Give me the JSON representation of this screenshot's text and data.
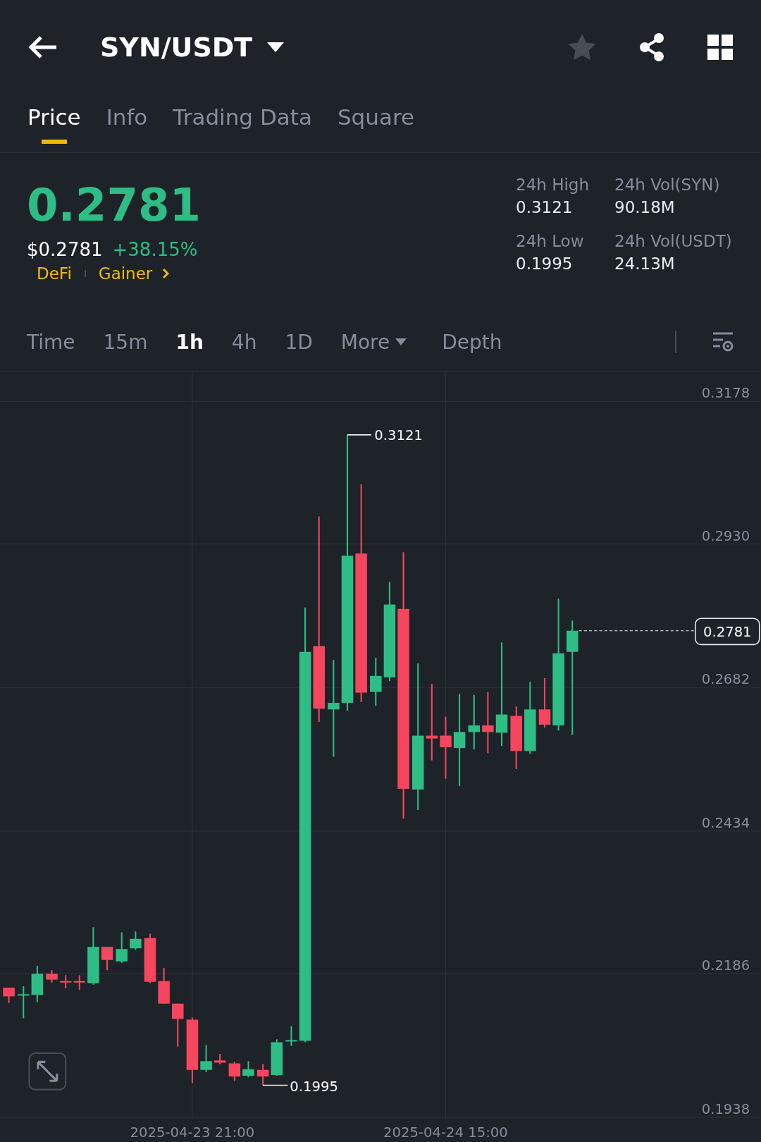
{
  "header": {
    "pair": "SYN/USDT"
  },
  "tabs": [
    {
      "label": "Price",
      "selected": true
    },
    {
      "label": "Info",
      "selected": false
    },
    {
      "label": "Trading Data",
      "selected": false
    },
    {
      "label": "Square",
      "selected": false
    }
  ],
  "price": {
    "last": "0.2781",
    "usd": "$0.2781",
    "change": "+38.15%",
    "tags": [
      "DeFi",
      "Gainer"
    ]
  },
  "stats": [
    {
      "label": "24h High",
      "value": "0.3121"
    },
    {
      "label": "24h Vol(SYN)",
      "value": "90.18M"
    },
    {
      "label": "24h Low",
      "value": "0.1995"
    },
    {
      "label": "24h Vol(USDT)",
      "value": "24.13M"
    }
  ],
  "intervals": [
    {
      "label": "Time",
      "kind": "interval",
      "selected": false
    },
    {
      "label": "15m",
      "kind": "interval",
      "selected": false
    },
    {
      "label": "1h",
      "kind": "interval",
      "selected": true
    },
    {
      "label": "4h",
      "kind": "interval",
      "selected": false
    },
    {
      "label": "1D",
      "kind": "interval",
      "selected": false
    },
    {
      "label": "More",
      "kind": "dropdown",
      "selected": false
    },
    {
      "label": "Depth",
      "kind": "interval",
      "selected": false
    }
  ],
  "chart": {
    "y_labels": [
      "0.3178",
      "0.2930",
      "0.2682",
      "0.2434",
      "0.2186",
      "0.1938"
    ],
    "x_labels": [
      "2025-04-23 21:00",
      "2025-04-24 15:00"
    ],
    "high_label": "0.3121",
    "low_label": "0.1995",
    "last_price_label": "0.2781"
  }
}
